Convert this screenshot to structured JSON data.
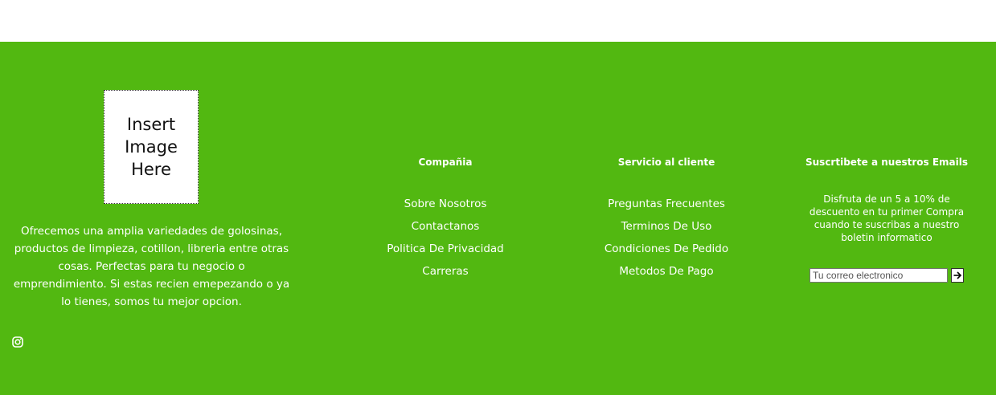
{
  "logo": {
    "placeholder_text": "Insert\nImage\nHere"
  },
  "about": {
    "text": "Ofrecemos una amplia variedades de golosinas, productos de limpieza, cotillon, libreria entre otras cosas. Perfectas para tu negocio o emprendimiento. Si estas recien emepezando o ya lo tienes, somos tu mejor opcion."
  },
  "social": {
    "icons": [
      "instagram-icon"
    ]
  },
  "company": {
    "title": "Compañia",
    "links": [
      "Sobre Nosotros",
      "Contactanos",
      "Politica De Privacidad",
      "Carreras"
    ]
  },
  "service": {
    "title": "Servicio al cliente",
    "links": [
      "Preguntas Frecuentes",
      "Terminos De Uso",
      "Condiciones De Pedido",
      "Metodos De Pago"
    ]
  },
  "newsletter": {
    "title": "Suscrtibete a nuestros Emails",
    "text": "Disfruta de un 5 a 10% de descuento en tu primer Compra cuando te suscribas a nuestro boletin informatico",
    "input_placeholder": "Tu correo electronico",
    "submit_icon": "arrow-right-icon"
  },
  "colors": {
    "footer_background": "#52b811",
    "text": "#ffffff"
  }
}
